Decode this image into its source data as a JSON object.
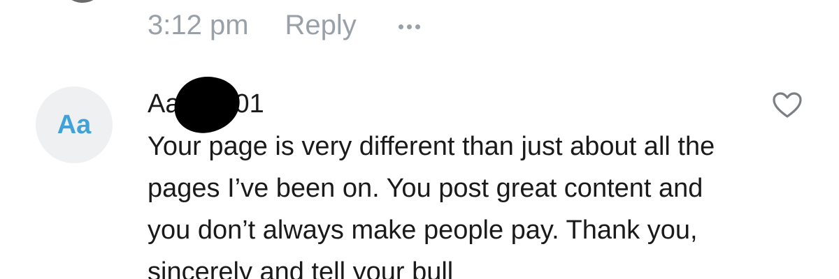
{
  "previous_comment": {
    "time": "3:12 pm",
    "reply_label": "Reply",
    "more_icon": "more-horizontal-icon"
  },
  "comment": {
    "avatar_initials": "Aa",
    "author": "Aa01",
    "author_prefix": "Aa",
    "author_suffix": "01",
    "text": "Your page is very different than just about all the pages I’ve been on. You post great content and you don’t always make people pay. Thank you, sincerely and tell your bull",
    "like_icon": "heart-outline-icon"
  },
  "colors": {
    "meta_text": "#9aa0a8",
    "avatar_bg": "#eef0f2",
    "avatar_text": "#3fa3d8",
    "body_text": "#1a1a1a",
    "heart_stroke": "#7b7f84"
  }
}
